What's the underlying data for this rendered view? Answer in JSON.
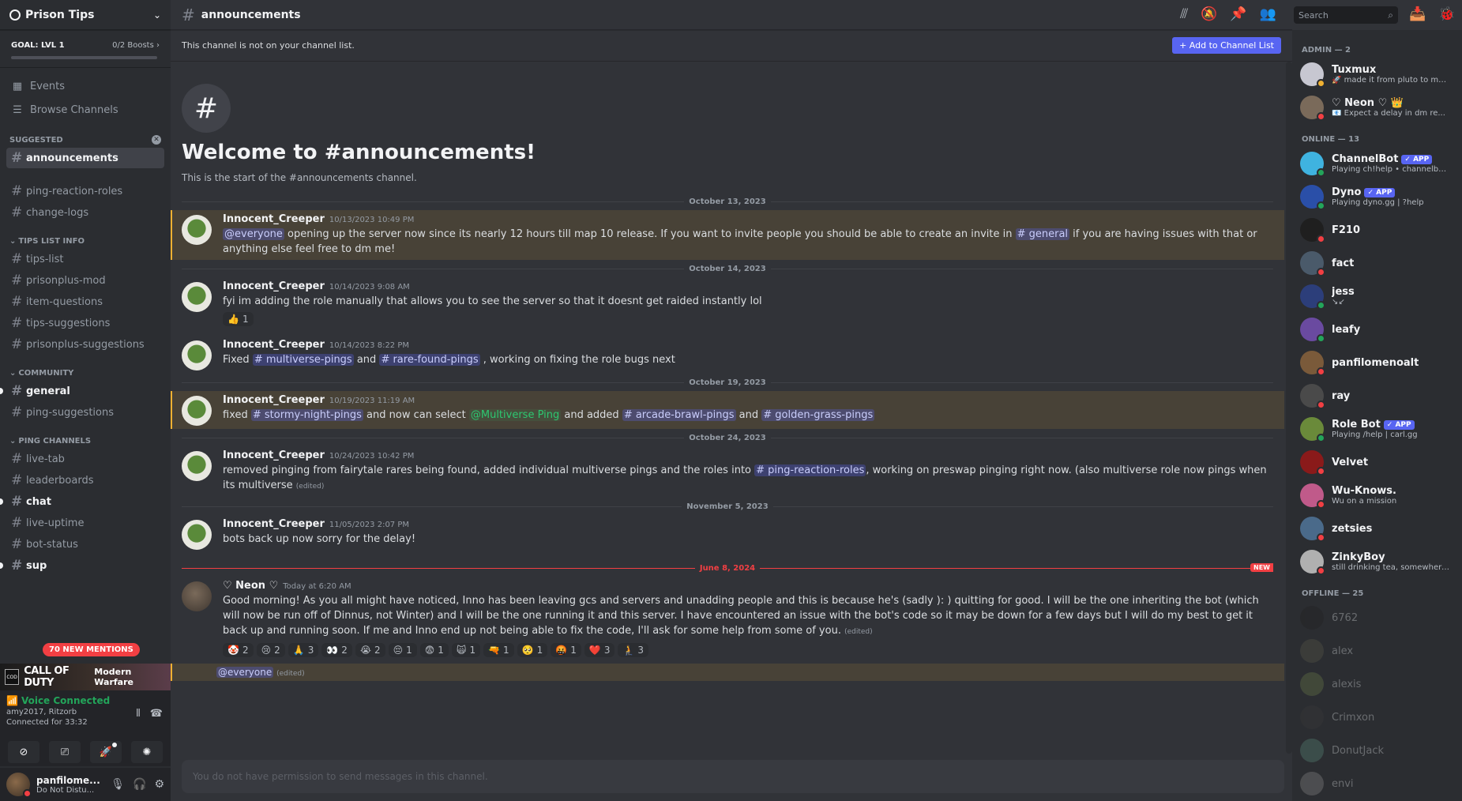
{
  "server": {
    "name": "Prison Tips",
    "goal_label": "GOAL: LVL 1",
    "boosts": "0/2 Boosts"
  },
  "nav": {
    "events": "Events",
    "browse": "Browse Channels"
  },
  "categories": {
    "suggested": "SUGGESTED",
    "tips": "TIPS LIST INFO",
    "community": "COMMUNITY",
    "ping": "PING CHANNELS"
  },
  "channels": {
    "suggested": [
      "announcements"
    ],
    "uncat": [
      "ping-reaction-roles",
      "change-logs"
    ],
    "tips": [
      "tips-list",
      "prisonplus-mod",
      "item-questions",
      "tips-suggestions",
      "prisonplus-suggestions"
    ],
    "community": [
      "general",
      "ping-suggestions"
    ],
    "ping": [
      "live-tab",
      "leaderboards",
      "chat",
      "live-uptime",
      "bot-status",
      "sup"
    ]
  },
  "mentions_pill": "70 NEW MENTIONS",
  "activity_banner": {
    "logo": "CALL OF DUTY",
    "title": "CALL OF DUTY",
    "subtitle": "Modern Warfare"
  },
  "voice": {
    "status": "Voice Connected",
    "where": "amy2017, Ritzorb",
    "connected": "Connected for 33:32"
  },
  "user": {
    "name": "panfilome...",
    "status": "Do Not Distu..."
  },
  "header": {
    "channel": "announcements",
    "search_placeholder": "Search"
  },
  "notice": {
    "text": "This channel is not on your channel list.",
    "button": "+ Add to Channel List"
  },
  "welcome": {
    "hash": "#",
    "title": "Welcome to #announcements!",
    "subtitle": "This is the start of the #announcements channel."
  },
  "messages": [
    {
      "date": "October 13, 2023",
      "author": "Innocent_Creeper",
      "time": "10/13/2023 10:49 PM",
      "parts": [
        "@everyone",
        " opening up the server now since its nearly 12 hours till map 10 release. If you want to invite people you should be able to create an invite in ",
        "# general",
        " if you are having issues with that or anything else feel free to dm me!"
      ]
    },
    {
      "date": "October 14, 2023",
      "author": "Innocent_Creeper",
      "time": "10/14/2023 9:08 AM",
      "text": "fyi im adding the role manually that allows you to see the server so that it doesnt get raided instantly lol",
      "reaction": {
        "emoji": "👍",
        "count": "1"
      }
    },
    {
      "author": "Innocent_Creeper",
      "time": "10/14/2023 8:22 PM",
      "parts": [
        "Fixed ",
        "# multiverse-pings",
        " and ",
        "# rare-found-pings",
        " , working on fixing the role bugs next"
      ]
    },
    {
      "date": "October 19, 2023",
      "author": "Innocent_Creeper",
      "time": "10/19/2023 11:19 AM",
      "parts": [
        "fixed ",
        "# stormy-night-pings",
        " and now can select ",
        "@Multiverse Ping",
        " and added ",
        "# arcade-brawl-pings",
        " and ",
        "# golden-grass-pings"
      ]
    },
    {
      "date": "October 24, 2023",
      "author": "Innocent_Creeper",
      "time": "10/24/2023 10:42 PM",
      "parts": [
        "removed pinging from fairytale rares being found, added individual multiverse pings and the roles into ",
        "# ping-reaction-roles",
        ", working on preswap pinging right now. (also multiverse role now pings when its multiverse "
      ],
      "edited": "(edited)"
    },
    {
      "date": "November 5, 2023",
      "author": "Innocent_Creeper",
      "time": "11/05/2023 2:07 PM",
      "text": "bots back up now sorry for the delay!"
    },
    {
      "date": "June 8, 2024",
      "new_badge": "NEW",
      "author": "♡ Neon ♡",
      "time": "Today at 6:20 AM",
      "text": "Good morning! As you all might have noticed, Inno has been leaving gcs and servers and unadding people and this is because he's (sadly ): ) quitting for good. I will be the one inheriting the bot (which will now be run off of Dinnus, not Winter) and I will be the one running it and this server. I have encountered an issue with the bot's code so it may be down for a few days but I will do my best to get it back up and running soon. If me and Inno end up not being able to fix the code, I'll ask for some help from some of you.",
      "edited": "(edited)",
      "reactions": [
        {
          "emoji": "🤡",
          "count": "2"
        },
        {
          "emoji": "😢",
          "count": "2"
        },
        {
          "emoji": "🙏",
          "count": "3"
        },
        {
          "emoji": "👀",
          "count": "2"
        },
        {
          "emoji": "😭",
          "count": "2"
        },
        {
          "emoji": "😔",
          "count": "1"
        },
        {
          "emoji": "😨",
          "count": "1"
        },
        {
          "emoji": "🙀",
          "count": "1"
        },
        {
          "emoji": "🔫",
          "count": "1"
        },
        {
          "emoji": "🥺",
          "count": "1"
        },
        {
          "emoji": "🤬",
          "count": "1"
        },
        {
          "emoji": "❤️",
          "count": "3"
        },
        {
          "emoji": "🧎",
          "count": "3"
        }
      ]
    }
  ],
  "followup": {
    "mention": "@everyone",
    "edited": "(edited)"
  },
  "composer_placeholder": "You do not have permission to send messages in this channel.",
  "members": {
    "admin_label": "ADMIN — 2",
    "admin": [
      {
        "name": "Tuxmux",
        "activity": "🚀 made it from pluto to mars",
        "status": "idle",
        "color": "#c7c7d1"
      },
      {
        "name": "♡ Neon ♡ 👑",
        "activity": "📧 Expect a delay in dm re...",
        "status": "dnd",
        "color": "#7a6a5a"
      }
    ],
    "online_label": "ONLINE — 13",
    "online": [
      {
        "name": "ChannelBot",
        "app": "✓ APP",
        "activity": "Playing ch!help • channelbot...",
        "status": "online",
        "color": "#3fb3e0"
      },
      {
        "name": "Dyno",
        "app": "✓ APP",
        "activity": "Playing dyno.gg | ?help",
        "status": "online",
        "color": "#2a4fa8"
      },
      {
        "name": "F210",
        "activity": "",
        "status": "dnd",
        "color": "#1f1f1f"
      },
      {
        "name": "fact",
        "activity": "",
        "status": "dnd",
        "color": "#4a5a6a"
      },
      {
        "name": "jess",
        "activity": "↘↙",
        "status": "online",
        "color": "#2c3e7a"
      },
      {
        "name": "leafy",
        "activity": "",
        "status": "online",
        "color": "#6a4aa0"
      },
      {
        "name": "panfilomenoalt",
        "activity": "",
        "status": "dnd",
        "color": "#7a5a3a"
      },
      {
        "name": "ray",
        "activity": "",
        "status": "dnd",
        "color": "#4a4a4a"
      },
      {
        "name": "Role Bot",
        "app": "✓ APP",
        "activity": "Playing /help | carl.gg",
        "status": "online",
        "color": "#6a8a3a"
      },
      {
        "name": "Velvet",
        "activity": "",
        "status": "dnd",
        "color": "#8a1a1a"
      },
      {
        "name": "Wu-Knows.",
        "activity": "Wu on a mission",
        "status": "dnd",
        "color": "#c05a8a"
      },
      {
        "name": "zetsies",
        "activity": "",
        "status": "dnd",
        "color": "#4a6a8a"
      },
      {
        "name": "ZinkyBoy",
        "activity": "still drinking tea, somewhere i...",
        "status": "dnd",
        "color": "#b0b0b0"
      }
    ],
    "offline_label": "OFFLINE — 25",
    "offline": [
      {
        "name": "6762",
        "color": "#202020"
      },
      {
        "name": "alex",
        "color": "#5a5a4a"
      },
      {
        "name": "alexis",
        "color": "#6a7a4a"
      },
      {
        "name": "Crimxon",
        "color": "#3a3a3a"
      },
      {
        "name": "DonutJack",
        "color": "#5a8a7a"
      },
      {
        "name": "envi",
        "color": "#8a8a8a"
      }
    ]
  }
}
